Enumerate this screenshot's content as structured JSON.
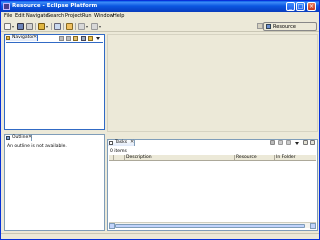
{
  "window": {
    "title": "Resource - Eclipse Platform"
  },
  "menu": [
    "File",
    "Edit",
    "Navigate",
    "Search",
    "Project",
    "Run",
    "Window",
    "Help"
  ],
  "perspective": {
    "label": "Resource"
  },
  "navigator": {
    "tab_label": "Navigator",
    "close": "✕"
  },
  "outline": {
    "tab_label": "Outline",
    "close": "✕",
    "message": "An outline is not available."
  },
  "tasks": {
    "tab_label": "Tasks",
    "close": "✕",
    "count": "0 items",
    "columns": [
      "",
      "",
      "Description",
      "Resource",
      "In Folder"
    ]
  },
  "icons": {
    "window": "eclipse-icon",
    "minimize": "minimize-icon",
    "maximize": "maximize-icon",
    "close": "close-icon"
  },
  "colors": {
    "titlebar": "#0a58e0",
    "active_border": "#316ac5",
    "frame": "#ece9d8"
  }
}
